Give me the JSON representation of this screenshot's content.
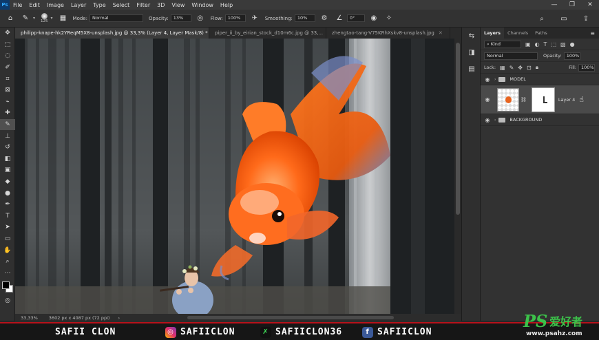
{
  "menubar": {
    "logo": "Ps",
    "items": [
      "File",
      "Edit",
      "Image",
      "Layer",
      "Type",
      "Select",
      "Filter",
      "3D",
      "View",
      "Window",
      "Help"
    ],
    "window_controls": [
      "—",
      "❐",
      "✕"
    ]
  },
  "options": {
    "brush_size": "125",
    "mode_label": "Mode:",
    "mode_value": "Normal",
    "opacity_label": "Opacity:",
    "opacity_value": "13%",
    "flow_label": "Flow:",
    "flow_value": "100%",
    "smoothing_label": "Smoothing:",
    "smoothing_value": "10%",
    "angle_value": "0°"
  },
  "tabs": [
    {
      "label": "philipp-knape-hk2YReqM5X8-unsplash.jpg @ 33,3% (Layer 4, Layer Mask/8) *"
    },
    {
      "label": "piper_ii_by_eirian_stock_d10m6c.jpg @ 33,..."
    },
    {
      "label": "zhengtao-tang-V75KRhXskv8-unsplash.jpg"
    }
  ],
  "status": {
    "zoom": "33,33%",
    "doc_info": "3602 px x 4087 px (72 ppi)"
  },
  "layers_panel": {
    "tabs": [
      "Layers",
      "Channels",
      "Paths"
    ],
    "kind_label": "Kind",
    "blend_mode": "Normal",
    "opacity_label": "Opacity:",
    "opacity_value": "100%",
    "lock_label": "Lock:",
    "fill_label": "Fill:",
    "fill_value": "100%",
    "layers": [
      {
        "name": "MODEL",
        "type": "group"
      },
      {
        "name": "Layer 4",
        "type": "layer"
      },
      {
        "name": "BACKGROUND",
        "type": "group"
      }
    ]
  },
  "banner": {
    "name": "SAFII CLON",
    "instagram": "SAFIICLON",
    "other": "SAFIICLON36",
    "facebook": "SAFIICLON",
    "accent": "#b8121b"
  },
  "watermark": {
    "ps": "PS",
    "text": "爱好者",
    "url": "www.psahz.com"
  }
}
